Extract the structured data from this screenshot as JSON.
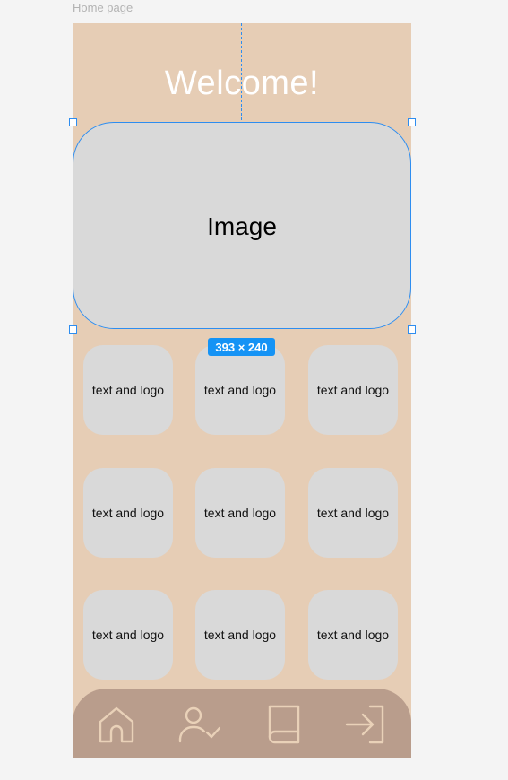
{
  "frame": {
    "label": "Home page"
  },
  "header": {
    "title": "Welcome!"
  },
  "image_card": {
    "label": "Image"
  },
  "selection": {
    "size_badge": "393 × 240"
  },
  "grid": {
    "tiles": [
      {
        "label": "text and logo"
      },
      {
        "label": "text and logo"
      },
      {
        "label": "text and logo"
      },
      {
        "label": "text and logo"
      },
      {
        "label": "text and logo"
      },
      {
        "label": "text and logo"
      },
      {
        "label": "text and logo"
      },
      {
        "label": "text and logo"
      },
      {
        "label": "text and logo"
      }
    ]
  },
  "nav": {
    "items": [
      {
        "icon": "home-icon"
      },
      {
        "icon": "user-check-icon"
      },
      {
        "icon": "book-icon"
      },
      {
        "icon": "login-icon"
      }
    ]
  },
  "colors": {
    "frame_bg": "#e6cdb5",
    "nav_bg": "#b99d8c",
    "tile_bg": "#d9d9d9",
    "selection": "#2d8df0"
  }
}
